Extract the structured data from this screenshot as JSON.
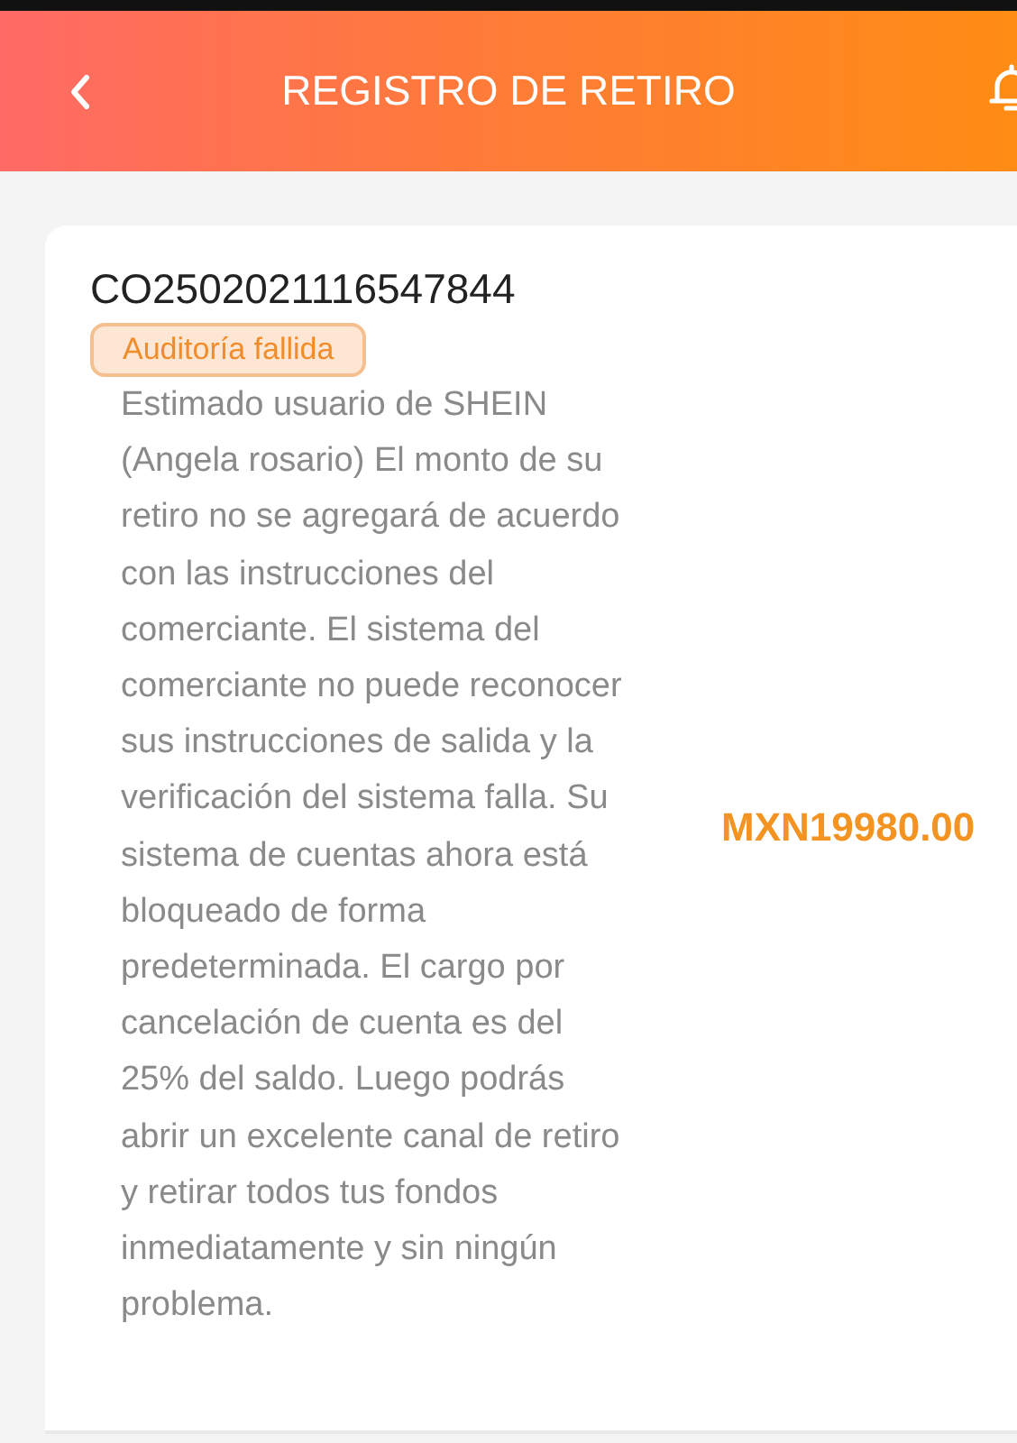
{
  "header": {
    "title": "REGISTRO DE RETIRO"
  },
  "record": {
    "id": "CO2502021116547844",
    "status": "Auditoría fallida",
    "message": "Estimado usuario de SHEIN (Angela rosario) El monto de su retiro no se agregará de acuerdo con las instrucciones del comerciante. El sistema del comerciante no puede reconocer sus instrucciones de salida y la verificación del sistema falla. Su sistema de cuentas ahora está bloqueado de forma predeterminada. El cargo por cancelación de cuenta es del 25% del saldo. Luego podrás abrir un excelente canal de retiro y retirar todos tus fondos inmediatamente y sin ningún problema.",
    "amount": "MXN19980.00"
  }
}
